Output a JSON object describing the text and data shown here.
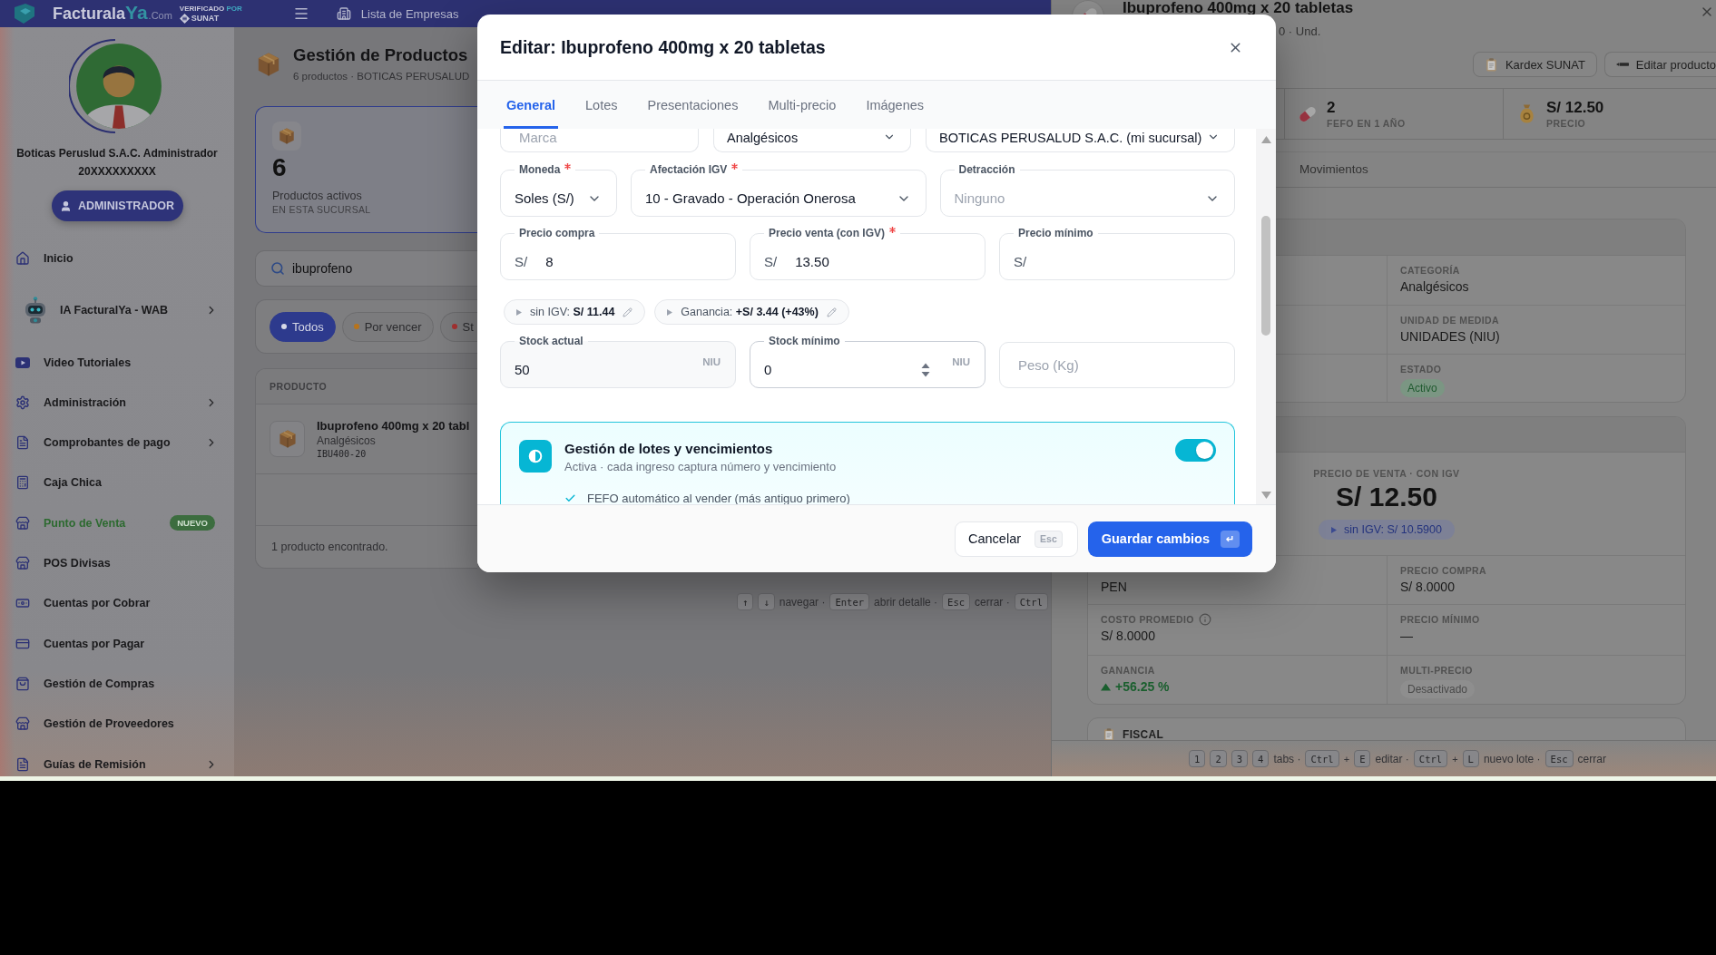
{
  "top_bar": {
    "logo": {
      "text": "Facturala",
      "accent": "Ya",
      "suffix": ".Com"
    },
    "seal": {
      "line1": "VERIFICADO",
      "line1_accent": "POR",
      "line2": "SUNAT"
    },
    "companies_link": "Lista de Empresas"
  },
  "sidebar": {
    "user": {
      "name": "Boticas Peruslud S.A.C. Administrador",
      "ruc": "20XXXXXXXXX",
      "role": "ADMINISTRADOR"
    },
    "items": [
      {
        "label": "Inicio",
        "kind": "link",
        "submenu": false
      },
      {
        "label": "IA FacturalYa - WAB",
        "kind": "assistant",
        "submenu": true
      },
      {
        "label": "Video Tutoriales",
        "kind": "link",
        "submenu": false
      },
      {
        "label": "Administración",
        "kind": "link",
        "submenu": true
      },
      {
        "label": "Comprobantes de pago",
        "kind": "link",
        "submenu": true
      },
      {
        "label": "Caja Chica",
        "kind": "link",
        "submenu": false
      },
      {
        "label": "Punto de Venta",
        "kind": "new",
        "submenu": false,
        "badge": "NUEVO"
      },
      {
        "label": "POS Divisas",
        "kind": "link",
        "submenu": false
      },
      {
        "label": "Cuentas por Cobrar",
        "kind": "link",
        "submenu": false
      },
      {
        "label": "Cuentas por Pagar",
        "kind": "link",
        "submenu": false
      },
      {
        "label": "Gestión de Compras",
        "kind": "link",
        "submenu": false
      },
      {
        "label": "Gestión de Proveedores",
        "kind": "link",
        "submenu": false
      },
      {
        "label": "Guías de Remisión",
        "kind": "link",
        "submenu": true
      }
    ]
  },
  "products": {
    "title": "Gestión de Productos",
    "subtitle": "6 productos · BOTICAS PERUSALUD",
    "stat": {
      "value": "6",
      "label": "Productos activos",
      "caption": "EN ESTA SUCURSAL"
    },
    "search": {
      "value": "ibuprofeno"
    },
    "filters": [
      {
        "label": "Todos",
        "selected": true,
        "color": "#d6d8e6"
      },
      {
        "label": "Por vencer",
        "selected": false,
        "color": "#b8741c"
      },
      {
        "label": "St",
        "selected": false,
        "color": "#a83232"
      }
    ],
    "table": {
      "columns": [
        "PRODUCTO"
      ],
      "rows": [
        {
          "name": "Ibuprofeno 400mg x 20 tabl",
          "category": "Analgésicos",
          "code": "IBU400-20"
        }
      ],
      "footer": "1 producto encontrado."
    },
    "shortcuts": [
      {
        "kind": "key",
        "text": "↑"
      },
      {
        "kind": "key",
        "text": "↓"
      },
      {
        "kind": "label",
        "text": "navegar ·"
      },
      {
        "kind": "key",
        "text": "Enter"
      },
      {
        "kind": "label",
        "text": "abrir detalle ·"
      },
      {
        "kind": "key",
        "text": "Esc"
      },
      {
        "kind": "label",
        "text": "cerrar ·"
      },
      {
        "kind": "key",
        "text": "Ctrl"
      }
    ]
  },
  "product_drawer": {
    "title": "Ibuprofeno 400mg x 20 tabletas",
    "subtitle": "0 · Und.",
    "actions": [
      "Kardex SUNAT",
      "Editar producto"
    ],
    "stats": [
      {
        "value": "2",
        "label": "FEFO EN 1 AÑO"
      },
      {
        "value": "S/ 12.50",
        "label": "PRECIO"
      }
    ],
    "tabs": [
      {
        "label": "Movimientos",
        "selected": false
      }
    ],
    "details": [
      {
        "label": "CATEGORÍA",
        "value": "Analgésicos",
        "kind": "text"
      },
      {
        "label": "UNIDAD DE MEDIDA",
        "value": "UNIDADES (NIU)",
        "kind": "text"
      },
      {
        "label": "ESTADO",
        "value": "Activo",
        "kind": "status"
      }
    ],
    "price": {
      "label": "PRECIO DE VENTA · CON IGV",
      "value": "S/ 12.50",
      "net": "sin IGV: S/ 10.5900"
    },
    "price_details": [
      [
        {
          "value": "PEN",
          "kind": "text"
        },
        {
          "label": "PRECIO COMPRA",
          "value": "S/ 8.0000",
          "kind": "text"
        }
      ],
      [
        {
          "label": "COSTO PROMEDIO",
          "value": "S/ 8.0000",
          "kind": "info"
        },
        {
          "label": "PRECIO MÍNIMO",
          "value": "—",
          "kind": "text"
        }
      ],
      [
        {
          "label": "GANANCIA",
          "value": "+56.25 %",
          "kind": "gain"
        },
        {
          "label": "MULTI-PRECIO",
          "value": "Desactivado",
          "kind": "tag"
        }
      ]
    ],
    "sections": [
      {
        "title": "FISCAL"
      }
    ],
    "shortcuts": [
      {
        "kind": "key",
        "text": "1"
      },
      {
        "kind": "key",
        "text": "2"
      },
      {
        "kind": "key",
        "text": "3"
      },
      {
        "kind": "key",
        "text": "4"
      },
      {
        "kind": "label",
        "text": "tabs ·"
      },
      {
        "kind": "key",
        "text": "Ctrl"
      },
      {
        "kind": "plus",
        "text": "+"
      },
      {
        "kind": "key",
        "text": "E"
      },
      {
        "kind": "label",
        "text": "editar ·"
      },
      {
        "kind": "key",
        "text": "Ctrl"
      },
      {
        "kind": "plus",
        "text": "+"
      },
      {
        "kind": "key",
        "text": "L"
      },
      {
        "kind": "label",
        "text": "nuevo lote ·"
      },
      {
        "kind": "key",
        "text": "Esc"
      },
      {
        "kind": "label",
        "text": "cerrar"
      }
    ]
  },
  "edit_modal": {
    "title": "Editar: Ibuprofeno 400mg x 20 tabletas",
    "tabs": [
      {
        "label": "General",
        "selected": true
      },
      {
        "label": "Lotes",
        "selected": false
      },
      {
        "label": "Presentaciones",
        "selected": false
      },
      {
        "label": "Multi-precio",
        "selected": false
      },
      {
        "label": "Imágenes",
        "selected": false
      }
    ],
    "form": [
      {
        "kind": "partial",
        "fields": [
          {
            "kind": "text",
            "placeholder": "Marca"
          },
          {
            "kind": "select",
            "value": "Analgésicos"
          },
          {
            "kind": "select",
            "value": "BOTICAS PERUSALUD S.A.C. (mi sucursal)"
          }
        ]
      },
      {
        "kind": "fields",
        "fields": [
          {
            "kind": "select",
            "label": "Moneda",
            "required": true,
            "value": "Soles (S/)"
          },
          {
            "kind": "select",
            "label": "Afectación IGV",
            "required": true,
            "value": "10 - Gravado - Operación Onerosa"
          },
          {
            "kind": "select",
            "label": "Detracción",
            "required": false,
            "placeholder": "Ninguno"
          }
        ]
      },
      {
        "kind": "fields",
        "fields": [
          {
            "kind": "money",
            "label": "Precio compra",
            "required": false,
            "prefix": "S/",
            "value": "8"
          },
          {
            "kind": "money",
            "label": "Precio venta (con IGV)",
            "required": true,
            "prefix": "S/",
            "value": "13.50"
          },
          {
            "kind": "money",
            "label": "Precio mínimo",
            "required": false,
            "prefix": "S/"
          }
        ]
      },
      {
        "kind": "chips",
        "chips": [
          {
            "text": "sin IGV: **S/ 11.44**"
          },
          {
            "text": "Ganancia: **+S/ 3.44 (+43%)**"
          }
        ]
      },
      {
        "kind": "fields",
        "fields": [
          {
            "kind": "readonly",
            "label": "Stock actual",
            "required": false,
            "value": "50",
            "suffix": "NIU"
          },
          {
            "kind": "stepper",
            "label": "Stock mínimo",
            "required": false,
            "value": "0",
            "suffix": "NIU"
          },
          {
            "kind": "text",
            "placeholder": "Peso (Kg)"
          }
        ]
      }
    ],
    "lot_tracking": {
      "title": "Gestión de lotes y vencimientos",
      "subtitle": "Activa · cada ingreso captura número y vencimiento",
      "on": true,
      "features": [
        {
          "text": "FEFO automático al vender (más antiguo primero)",
          "checked": true
        }
      ]
    },
    "footer": {
      "cancel": {
        "label": "Cancelar",
        "key": "Esc"
      },
      "save": {
        "label": "Guardar cambios",
        "key": "↵"
      }
    }
  }
}
